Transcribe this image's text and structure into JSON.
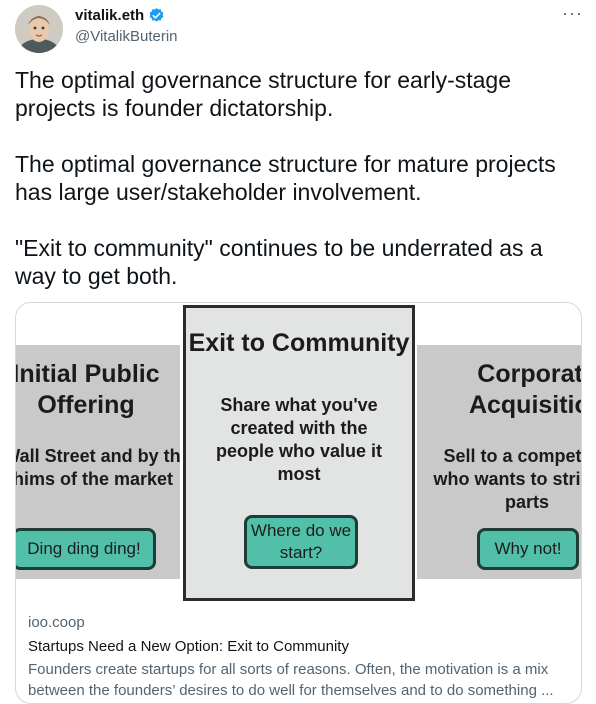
{
  "author": {
    "name": "vitalik.eth",
    "handle": "@VitalikButerin",
    "verified_color": "#1d9bf0"
  },
  "more_icon": "···",
  "tweet": {
    "paragraphs": [
      "The optimal governance structure for early-stage projects is founder dictatorship.",
      "The optimal governance structure for mature projects has large user/stakeholder involvement.",
      "\"Exit to community\" continues to be underrated as a way to get both."
    ]
  },
  "card": {
    "image": {
      "left_panel": {
        "title": "Initial Public Offering",
        "desc": "to Wall Street and by the whims of the market",
        "button": "Ding ding ding!"
      },
      "center_panel": {
        "title": "Exit to Community",
        "desc": "Share what you've created with the people who value it most",
        "button": "Where do we start?"
      },
      "right_panel": {
        "title": "Corporate Acquisition",
        "desc": "Sell to a competitor who wants to strip for parts",
        "button": "Why not!"
      },
      "button_color": "#52bfa9"
    },
    "domain": "ioo.coop",
    "title": "Startups Need a New Option: Exit to Community",
    "description": "Founders create startups for all sorts of reasons. Often, the motivation is a mix between the founders’ desires to do well for themselves and to do something ..."
  }
}
